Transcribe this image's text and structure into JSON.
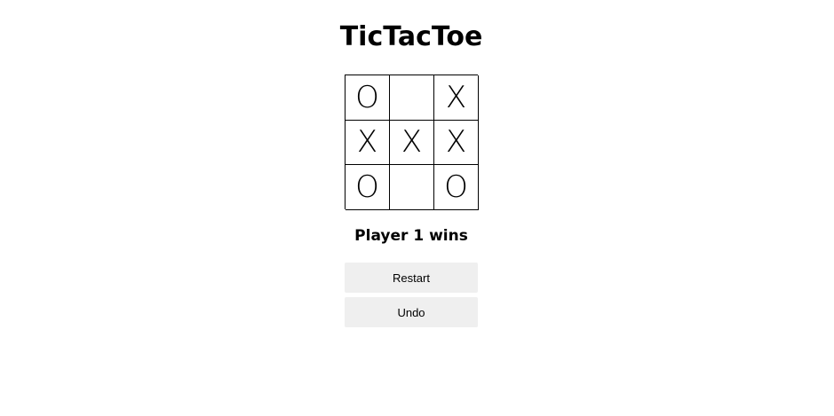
{
  "title": "TicTacToe",
  "board": [
    "O",
    "",
    "X",
    "X",
    "X",
    "X",
    "O",
    "",
    "O"
  ],
  "status": "Player 1 wins",
  "buttons": {
    "restart": "Restart",
    "undo": "Undo"
  }
}
